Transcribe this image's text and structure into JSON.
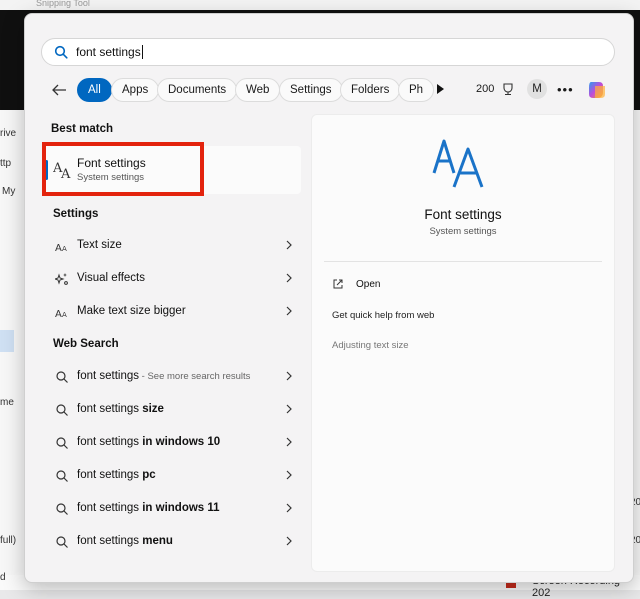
{
  "background": {
    "window_title": "Snipping Tool",
    "left_labels": [
      "rive",
      "ttp",
      "My",
      "me",
      "full)",
      "d"
    ],
    "right_labels": [
      "20",
      "20"
    ],
    "bottom_text": "Screen Recording 202"
  },
  "search": {
    "value": "font settings"
  },
  "filters": {
    "tabs": [
      {
        "label": "All",
        "active": true
      },
      {
        "label": "Apps"
      },
      {
        "label": "Documents"
      },
      {
        "label": "Web"
      },
      {
        "label": "Settings"
      },
      {
        "label": "Folders"
      },
      {
        "label": "Ph"
      }
    ],
    "points": "200",
    "avatar_initial": "M",
    "more": "•••"
  },
  "best_match": {
    "heading": "Best match",
    "title": "Font settings",
    "subtitle": "System settings"
  },
  "settings": {
    "heading": "Settings",
    "items": [
      {
        "label": "Text size"
      },
      {
        "label": "Visual effects"
      },
      {
        "label": "Make text size bigger"
      }
    ]
  },
  "web_search": {
    "heading": "Web Search",
    "items": [
      {
        "prefix": "font settings",
        "suffix": "",
        "hint": " - See more search results"
      },
      {
        "prefix": "font settings ",
        "suffix": "size",
        "hint": ""
      },
      {
        "prefix": "font settings ",
        "suffix": "in windows 10",
        "hint": ""
      },
      {
        "prefix": "font settings ",
        "suffix": "pc",
        "hint": ""
      },
      {
        "prefix": "font settings ",
        "suffix": "in windows 11",
        "hint": ""
      },
      {
        "prefix": "font settings ",
        "suffix": "menu",
        "hint": ""
      }
    ]
  },
  "preview": {
    "title": "Font settings",
    "subtitle": "System settings",
    "open_label": "Open",
    "quick_help": "Get quick help from web",
    "related": "Adjusting text size"
  },
  "colors": {
    "accent": "#0067c0",
    "highlight": "#e3230d"
  }
}
